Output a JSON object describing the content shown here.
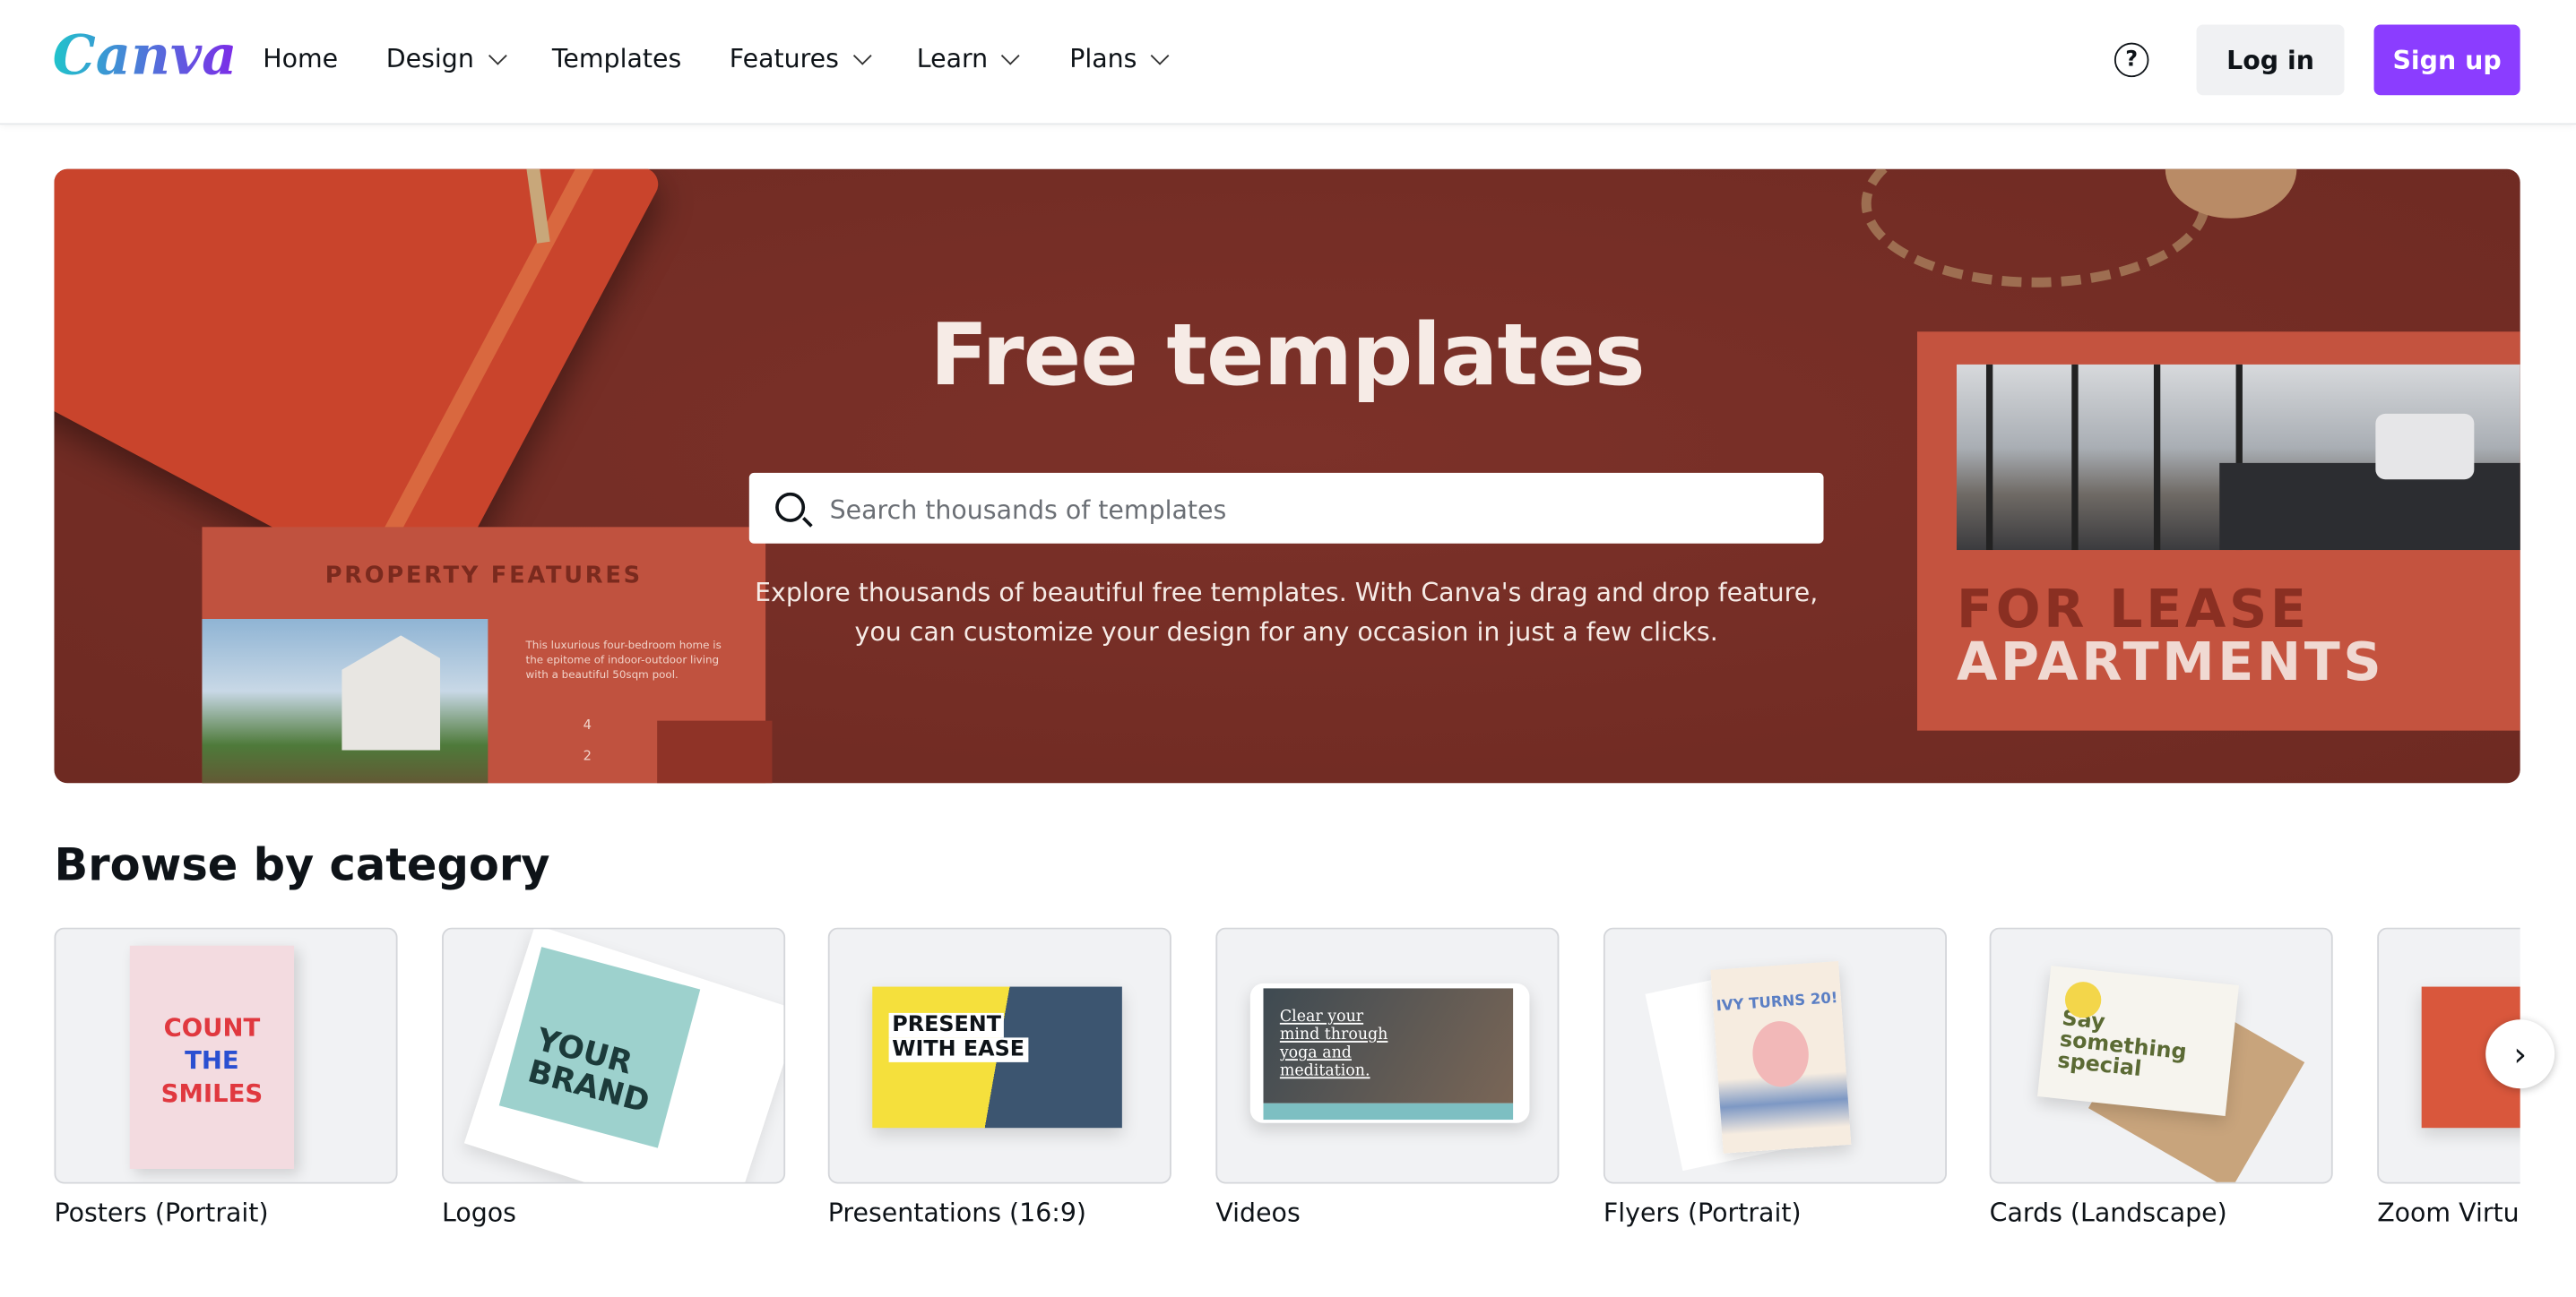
{
  "header": {
    "logo": "Canva",
    "nav": [
      {
        "label": "Home",
        "dropdown": false
      },
      {
        "label": "Design",
        "dropdown": true
      },
      {
        "label": "Templates",
        "dropdown": false
      },
      {
        "label": "Features",
        "dropdown": true
      },
      {
        "label": "Learn",
        "dropdown": true
      },
      {
        "label": "Plans",
        "dropdown": true
      }
    ],
    "help_icon": "question-circle-icon",
    "login": "Log in",
    "signup": "Sign up",
    "accent": "#8b3dff"
  },
  "hero": {
    "title": "Free templates",
    "search_placeholder": "Search thousands of templates",
    "search_value": "",
    "description": "Explore thousands of beautiful free templates. With Canva's drag and drop feature, you can customize your design for any occasion in just a few clicks.",
    "left_card": {
      "title": "PROPERTY FEATURES",
      "text": "This luxurious four-bedroom home is the epitome of indoor-outdoor living with a beautiful 50sqm pool.",
      "beds": "4",
      "baths": "2"
    },
    "right_card": {
      "line1": "FOR LEASE",
      "line2": "APARTMENTS"
    },
    "background": "#7a3128"
  },
  "browse": {
    "title": "Browse by category",
    "categories": [
      {
        "label": "Posters (Portrait)",
        "thumb": [
          "COUNT",
          "THE",
          "SMILES"
        ]
      },
      {
        "label": "Logos",
        "thumb": [
          "YOUR",
          "BRAND"
        ]
      },
      {
        "label": "Presentations (16:9)",
        "thumb": [
          "PRESENT",
          "WITH EASE"
        ]
      },
      {
        "label": "Videos",
        "thumb": [
          "Clear your",
          "mind through",
          "yoga and",
          "meditation."
        ]
      },
      {
        "label": "Flyers (Portrait)",
        "thumb": [
          "IVY TURNS 20!"
        ]
      },
      {
        "label": "Cards (Landscape)",
        "thumb": [
          "Say",
          "something",
          "special"
        ]
      },
      {
        "label": "Zoom Virtual Backgrounds",
        "thumb": []
      }
    ],
    "next_icon": "chevron-right-icon"
  }
}
